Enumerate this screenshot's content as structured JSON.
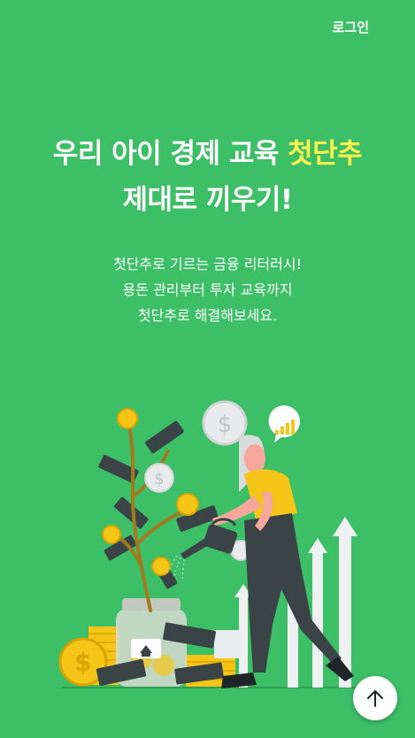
{
  "header": {
    "login_label": "로그인"
  },
  "hero": {
    "title_line1_prefix": "우리 아이 경제 교육 ",
    "title_line1_accent": "첫단추",
    "title_line2": "제대로 끼우기!",
    "subtitle_lines": [
      "첫단추로 기르는 금융 리터러시!",
      "용돈 관리부터 투자 교육까지",
      "첫단추로 해결해보세요."
    ]
  },
  "colors": {
    "background": "#3dbf67",
    "accent": "#fff24a",
    "coin": "#f5c518",
    "money": "#3a4447",
    "arrows": "#e9ecef"
  },
  "icons": {
    "scroll_top": "arrow-up-icon"
  }
}
